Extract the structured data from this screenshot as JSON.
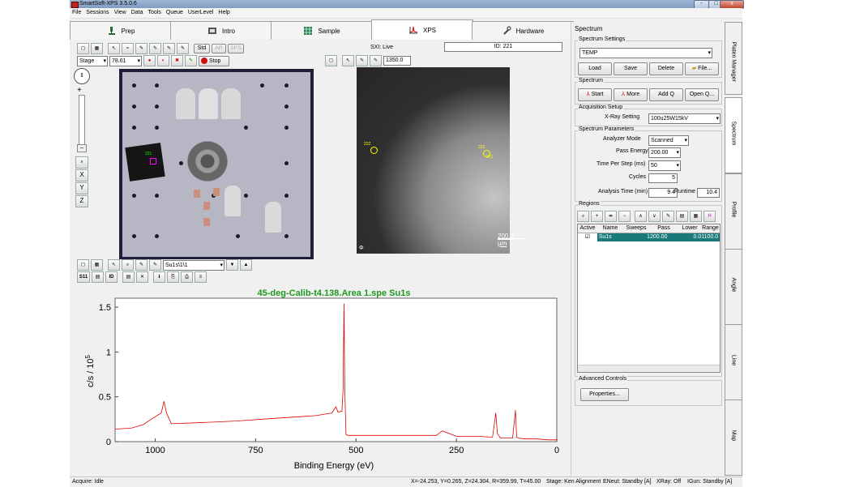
{
  "window": {
    "title": "SmartSoft-XPS 3.5.0.6",
    "controls": [
      "-",
      "□",
      "x"
    ]
  },
  "menu": [
    "File",
    "Sessions",
    "View",
    "Data",
    "Tools",
    "Queue",
    "UserLevel",
    "Help"
  ],
  "tabs": [
    {
      "label": "Prep",
      "icon": "microscope-icon"
    },
    {
      "label": "Intro",
      "icon": "film-icon"
    },
    {
      "label": "Sample",
      "icon": "grid-icon"
    },
    {
      "label": "XPS",
      "icon": "spectrum-icon",
      "active": true
    },
    {
      "label": "Hardware",
      "icon": "wrench-icon"
    }
  ],
  "stage": {
    "buttons1": [
      "Std",
      "AR",
      "SPS"
    ],
    "stage_select": "Stage",
    "stage_value": "78.61",
    "stop_label": "Stop",
    "nav": [
      "X",
      "Y",
      "Z"
    ],
    "sample_label": "221"
  },
  "sxi": {
    "title": "SXI: Live",
    "id_label": "ID: 221",
    "value": "1350.0",
    "scale": "200.0 µm",
    "markers": [
      "222",
      "223",
      "221"
    ]
  },
  "spec_toolbar": {
    "select": "Su1s\\1\\1",
    "btn_s11": "S11",
    "btn_id": "ID"
  },
  "chart_data": {
    "type": "line",
    "title": "45-deg-Calib-t4.138.Area 1.spe Su1s",
    "xlabel": "Binding Energy (eV)",
    "ylabel": "c/s / 10",
    "ylabel_exp": "5",
    "xlim": [
      1100,
      0
    ],
    "ylim": [
      0,
      1.6
    ],
    "xticks": [
      1000,
      750,
      500,
      250,
      0
    ],
    "yticks": [
      0,
      0.5,
      1,
      1.5
    ],
    "line_color": "#e00000",
    "title_color": "#1d9a1d",
    "x": [
      1100,
      1060,
      1030,
      1010,
      985,
      978,
      972,
      960,
      900,
      800,
      700,
      600,
      560,
      550,
      545,
      535,
      532,
      530,
      528,
      525,
      520,
      500,
      400,
      300,
      285,
      250,
      200,
      160,
      152,
      148,
      140,
      110,
      103,
      100,
      95,
      80,
      50,
      20,
      0
    ],
    "y": [
      0.14,
      0.15,
      0.19,
      0.25,
      0.32,
      0.45,
      0.32,
      0.2,
      0.21,
      0.23,
      0.26,
      0.29,
      0.32,
      0.39,
      0.33,
      0.34,
      0.6,
      1.54,
      0.6,
      0.08,
      0.07,
      0.07,
      0.07,
      0.07,
      0.12,
      0.06,
      0.06,
      0.05,
      0.32,
      0.09,
      0.04,
      0.04,
      0.35,
      0.05,
      0.04,
      0.03,
      0.03,
      0.02,
      0.02
    ]
  },
  "right": {
    "header": "Spectrum",
    "settings": {
      "group": "Spectrum Settings",
      "select": "TEMP",
      "buttons": [
        "Load",
        "Save",
        "Delete",
        "File..."
      ]
    },
    "spectrum": {
      "group": "Spectrum",
      "buttons": [
        "Start",
        "More",
        "Add Q",
        "Open Q..."
      ]
    },
    "acq": {
      "group": "Acquisition Setup",
      "label": "X-Ray Setting",
      "value": "100u25W15kV"
    },
    "params": {
      "group": "Spectrum Parameters",
      "analyzer_label": "Analyzer Mode",
      "analyzer": "Scanned",
      "pass_label": "Pass Energy",
      "pass": "200.00",
      "tps_label": "Time Per Step (ms)",
      "tps": "50",
      "cycles_label": "Cycles",
      "cycles": "5",
      "atime_label": "Analysis Time (min)",
      "atime": "9.4",
      "runtime_label": "Runtime",
      "runtime": "10.4"
    },
    "regions": {
      "group": "Regions",
      "columns": [
        "Active",
        "Name",
        "Sweeps",
        "Pass",
        "Lower",
        "Range"
      ],
      "row": {
        "active": "☑",
        "name": "Su1s",
        "sweeps": "1",
        "pass": "200.00",
        "lower": "0.0",
        "range": "1100.0"
      }
    },
    "advanced": {
      "group": "Advanced Controls",
      "button": "Properties..."
    }
  },
  "side_tabs": [
    "Platen Manager",
    "Spectrum",
    "Profile",
    "Angle",
    "Line",
    "Map"
  ],
  "status": {
    "left": "Acquire: Idle",
    "coords": "X=-24.253, Y=0.265, Z=24.304, R=359.99, T=45.00",
    "stage": "Stage: Ken Alignment",
    "eneut": "ENeut: Standby [A]",
    "xray": "XRay: Off",
    "igun": "IGun: Standby [A]"
  }
}
